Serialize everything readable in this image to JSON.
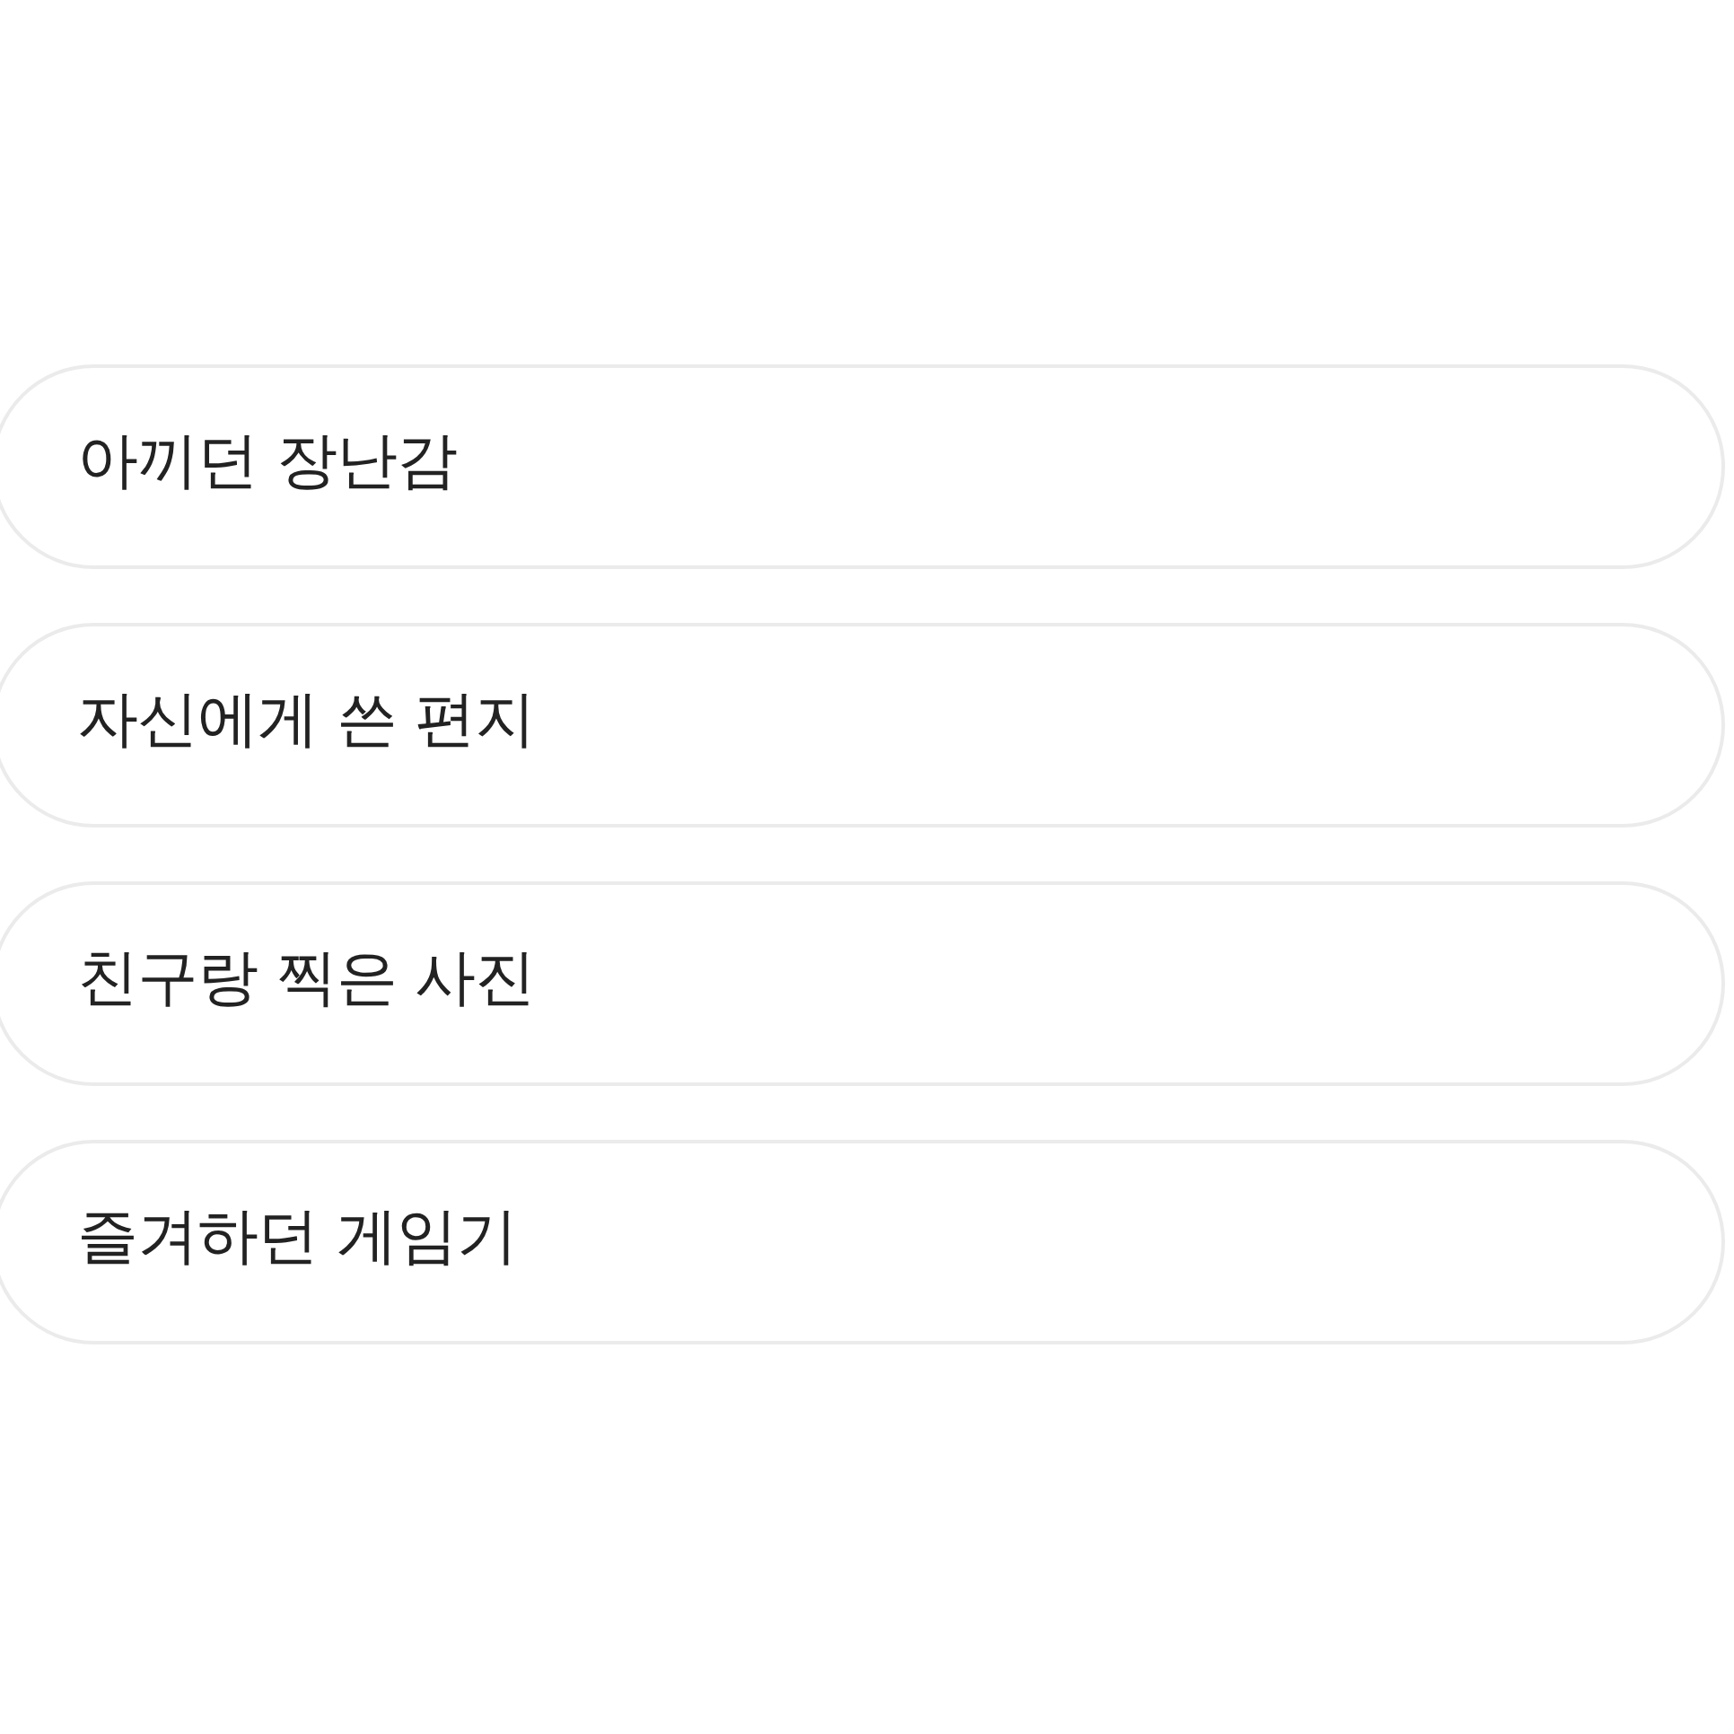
{
  "options": [
    {
      "label": "아끼던 장난감",
      "selected": false
    },
    {
      "label": "자신에게 쓴 편지",
      "selected": false
    },
    {
      "label": "친구랑 찍은 사진",
      "selected": false
    },
    {
      "label": "즐겨하던 게임기",
      "selected": false
    }
  ]
}
